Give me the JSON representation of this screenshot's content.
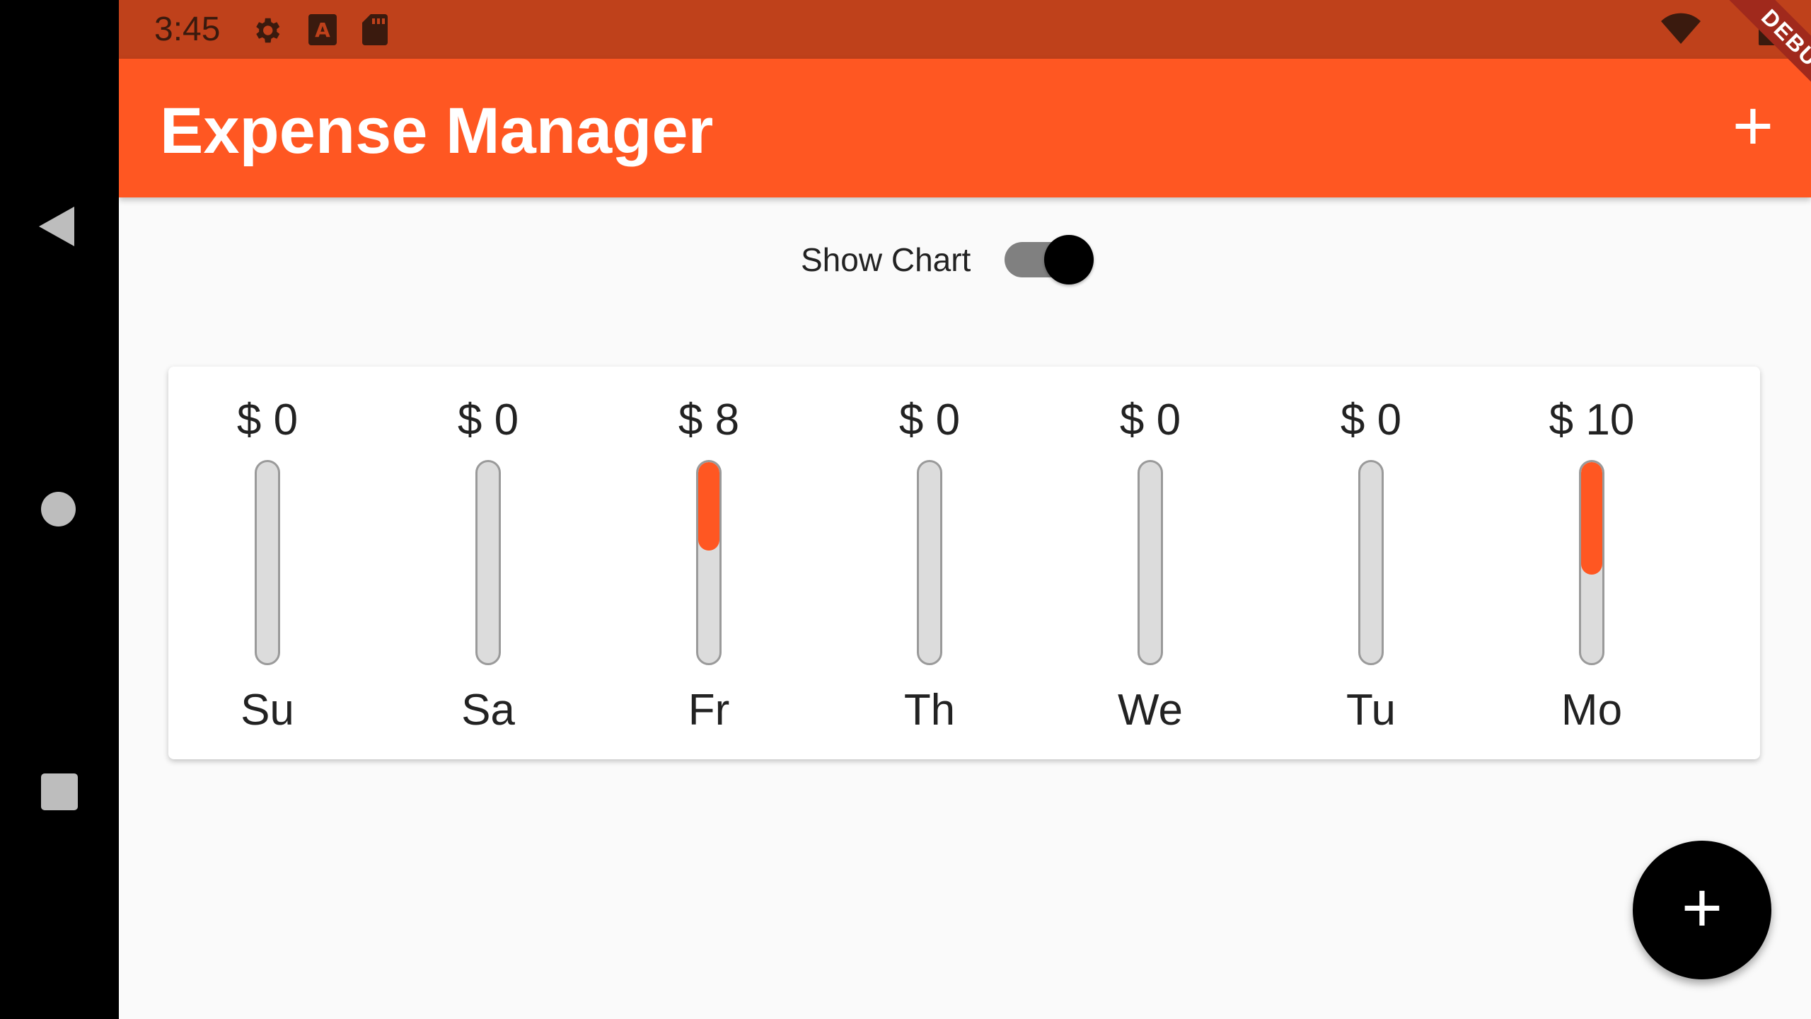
{
  "status_bar": {
    "time": "3:45",
    "icons": [
      "gear-icon",
      "a-icon",
      "sd-card-icon",
      "wifi-icon",
      "battery-icon"
    ]
  },
  "debug_banner": "DEBUG",
  "app_bar": {
    "title": "Expense Manager",
    "add_icon": "+"
  },
  "switch": {
    "label": "Show Chart",
    "on": true
  },
  "chart_data": {
    "type": "bar",
    "categories": [
      "Su",
      "Sa",
      "Fr",
      "Th",
      "We",
      "Tu",
      "Mo"
    ],
    "amount_labels": [
      "$ 0",
      "$ 0",
      "$ 8",
      "$ 0",
      "$ 0",
      "$ 0",
      "$ 10"
    ],
    "values": [
      0,
      0,
      8,
      0,
      0,
      0,
      10
    ],
    "fill_fraction": [
      0,
      0,
      0.44,
      0,
      0,
      0,
      0.56
    ]
  },
  "fab": {
    "icon": "+"
  },
  "colors": {
    "primary": "#ff5722",
    "status_bar": "#bf411b",
    "background": "#fafafa"
  }
}
